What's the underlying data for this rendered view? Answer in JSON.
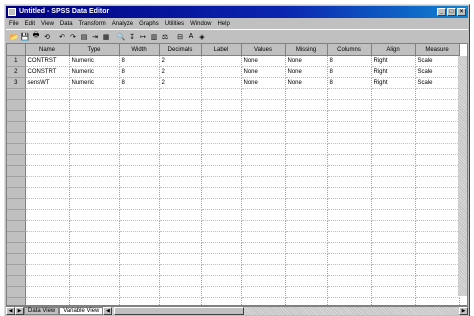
{
  "window": {
    "title": "Untitled - SPSS Data Editor",
    "buttons": [
      "_",
      "□",
      "×"
    ]
  },
  "menubar": [
    "File",
    "Edit",
    "View",
    "Data",
    "Transform",
    "Analyze",
    "Graphs",
    "Utilities",
    "Window",
    "Help"
  ],
  "toolbar": {
    "icons": [
      "open-icon",
      "save-icon",
      "print-icon",
      "dialog-recall-icon",
      "undo-icon",
      "redo-icon",
      "goto-chart-icon",
      "goto-case-icon",
      "variables-icon",
      "find-icon",
      "insert-case-icon",
      "insert-variable-icon",
      "split-file-icon",
      "weight-cases-icon",
      "select-cases-icon",
      "value-labels-icon",
      "use-sets-icon"
    ],
    "glyphs": [
      "📂",
      "💾",
      "🖶",
      "⟲",
      "↶",
      "↷",
      "▤",
      "⇥",
      "▦",
      "🔍",
      "↧",
      "↦",
      "▥",
      "⚖",
      "⊟",
      "A",
      "◈"
    ]
  },
  "grid": {
    "columns": [
      "Name",
      "Type",
      "Width",
      "Decimals",
      "Label",
      "Values",
      "Missing",
      "Columns",
      "Align",
      "Measure"
    ],
    "rows": [
      [
        "1",
        "CONTRST",
        "Numeric",
        "8",
        "2",
        "",
        "None",
        "None",
        "8",
        "Right",
        "Scale"
      ],
      [
        "2",
        "CONSTRT",
        "Numeric",
        "8",
        "2",
        "",
        "None",
        "None",
        "8",
        "Right",
        "Scale"
      ],
      [
        "3",
        "sensWT",
        "Numeric",
        "8",
        "2",
        "",
        "None",
        "None",
        "8",
        "Right",
        "Scale"
      ]
    ],
    "empty_row_count": 21
  },
  "tabs": {
    "data_view": "Data View",
    "variable_view": "Variable View"
  },
  "colors": {
    "title_start": "#000080",
    "title_end": "#1084d0",
    "chrome": "#c0c0c0"
  }
}
